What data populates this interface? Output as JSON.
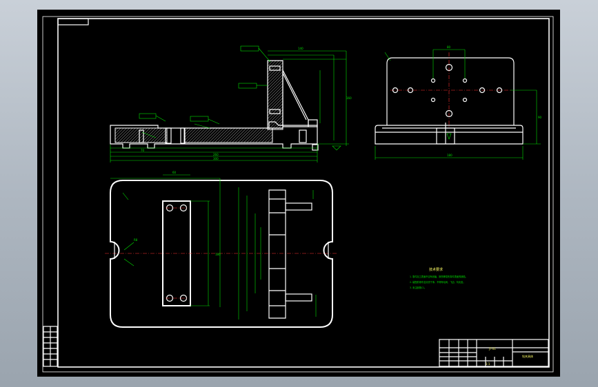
{
  "colors": {
    "background": "#000000",
    "outline": "#ffffff",
    "dimension": "#00e000",
    "centerline": "#ff3030",
    "frame": "#9aa4ae"
  },
  "front_view": {
    "dims": {
      "overall_width": "300",
      "base_length": "260",
      "left_offset": "70",
      "height": "160",
      "top_width": "140"
    }
  },
  "side_view": {
    "dims": {
      "top_width": "80",
      "height": "90",
      "overall": "180"
    }
  },
  "top_view": {
    "dims": {
      "width": "60",
      "length": "180",
      "slot": "R8"
    }
  },
  "notes": {
    "title": "技术要求",
    "lines": [
      "1. 零件加工表面不应有划痕、擦伤等损伤零件表面的缺陷。",
      "2. 装配前零件应清洗干净，不得有毛刺、飞边、氧化皮。",
      "3. 未注倒角C1。"
    ]
  },
  "title_block": {
    "code": "JT-01",
    "name": "钻夹具体",
    "scale": "1:1"
  }
}
